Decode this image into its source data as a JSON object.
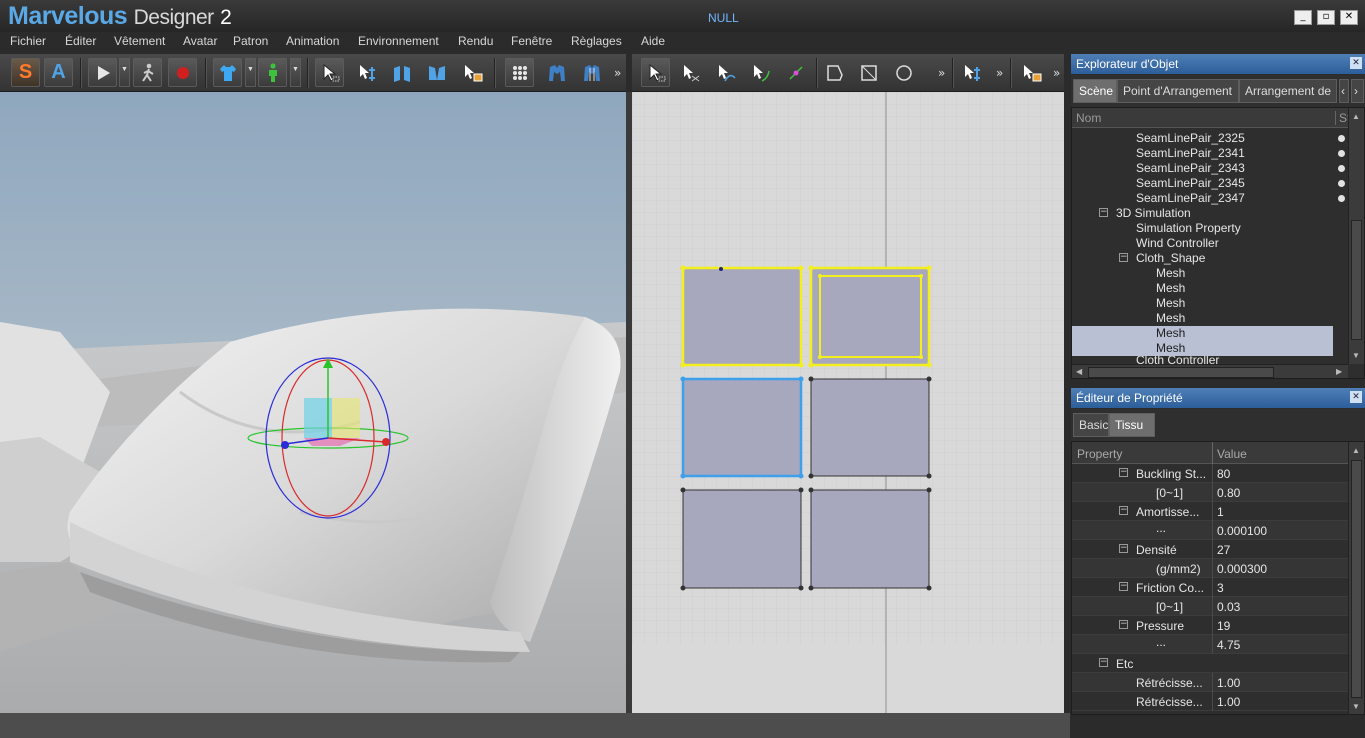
{
  "app": {
    "logo_main": "Marvelous",
    "logo_sub": "Designer",
    "logo_ver": "2",
    "doc_title": "NULL"
  },
  "window_controls": {
    "minimize": "_",
    "restore": "▫",
    "close": "✕"
  },
  "menu": [
    "Fichier",
    "Éditer",
    "Vêtement",
    "Avatar",
    "Patron",
    "Animation",
    "Environnement",
    "Rendu",
    "Fenêtre",
    "Règlages",
    "Aide"
  ],
  "toolbar": {
    "btn_s": "S",
    "btn_a": "A",
    "more": "»"
  },
  "object_explorer": {
    "title": "Explorateur d'Objet",
    "tabs": [
      "Scène",
      "Point d'Arrangement",
      "Arrangement de"
    ],
    "col_name": "Nom",
    "col_state": "St",
    "rows": [
      {
        "label": "SeamLinePair_2325",
        "dot": true
      },
      {
        "label": "SeamLinePair_2341",
        "dot": true
      },
      {
        "label": "SeamLinePair_2343",
        "dot": true
      },
      {
        "label": "SeamLinePair_2345",
        "dot": true
      },
      {
        "label": "SeamLinePair_2347",
        "dot": true
      },
      {
        "label": "3D Simulation"
      },
      {
        "label": "Simulation Property"
      },
      {
        "label": "Wind Controller"
      },
      {
        "label": "Cloth_Shape"
      },
      {
        "label": "Mesh"
      },
      {
        "label": "Mesh"
      },
      {
        "label": "Mesh"
      },
      {
        "label": "Mesh"
      },
      {
        "label": "Mesh",
        "selected": true
      },
      {
        "label": "Mesh",
        "selected": true
      },
      {
        "label": "Cloth Controller"
      }
    ]
  },
  "property_editor": {
    "title": "Éditeur de Propriété",
    "tabs": [
      "Basic",
      "Tissu"
    ],
    "col_property": "Property",
    "col_value": "Value",
    "rows": [
      {
        "name": "Buckling St...",
        "value": "80",
        "level": 1,
        "expander": "⊟"
      },
      {
        "name": "[0~1]",
        "value": "0.80",
        "level": 2
      },
      {
        "name": "Amortisse...",
        "value": "1",
        "level": 1,
        "expander": "⊟"
      },
      {
        "name": "...",
        "value": "0.000100",
        "level": 2
      },
      {
        "name": "Densité",
        "value": "27",
        "level": 1,
        "expander": "⊟"
      },
      {
        "name": "(g/mm2)",
        "value": "0.000300",
        "level": 2
      },
      {
        "name": "Friction Co...",
        "value": "3",
        "level": 1,
        "expander": "⊟"
      },
      {
        "name": "[0~1]",
        "value": "0.03",
        "level": 2
      },
      {
        "name": "Pressure",
        "value": "19",
        "level": 1,
        "expander": "⊟"
      },
      {
        "name": "...",
        "value": "4.75",
        "level": 2
      },
      {
        "name": "Etc",
        "value": "",
        "level": 0,
        "expander": "⊟"
      },
      {
        "name": "Rétrécisse...",
        "value": "1.00",
        "level": 1
      },
      {
        "name": "Rétrécisse...",
        "value": "1.00",
        "level": 1
      }
    ]
  }
}
